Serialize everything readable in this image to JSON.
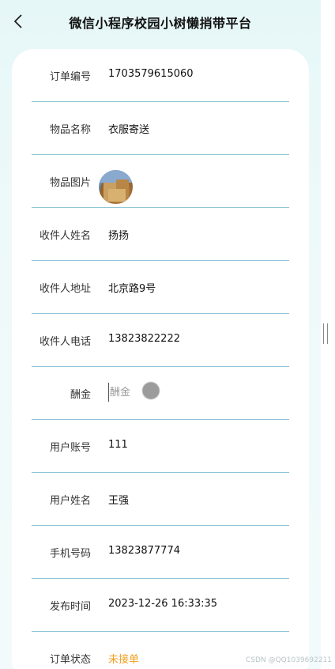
{
  "header": {
    "title": "微信小程序校园小树懒捎带平台"
  },
  "form": {
    "rows": [
      {
        "label": "订单编号",
        "value": "1703579615060"
      },
      {
        "label": "物品名称",
        "value": "衣服寄送"
      },
      {
        "label": "物品图片",
        "value": ""
      },
      {
        "label": "收件人姓名",
        "value": "扬扬"
      },
      {
        "label": "收件人地址",
        "value": "北京路9号"
      },
      {
        "label": "收件人电话",
        "value": "13823822222"
      },
      {
        "label": "酬金",
        "placeholder": "酬金"
      },
      {
        "label": "用户账号",
        "value": "111"
      },
      {
        "label": "用户姓名",
        "value": "王强"
      },
      {
        "label": "手机号码",
        "value": "13823877774"
      },
      {
        "label": "发布时间",
        "value": "2023-12-26 16:33:35"
      },
      {
        "label": "订单状态",
        "value": "未接单"
      }
    ]
  },
  "colors": {
    "accent_status": "#f0a020",
    "divider": "#8ec5d6",
    "background": "#e6f7f7"
  },
  "watermark": "CSDN @QQ1039692211"
}
